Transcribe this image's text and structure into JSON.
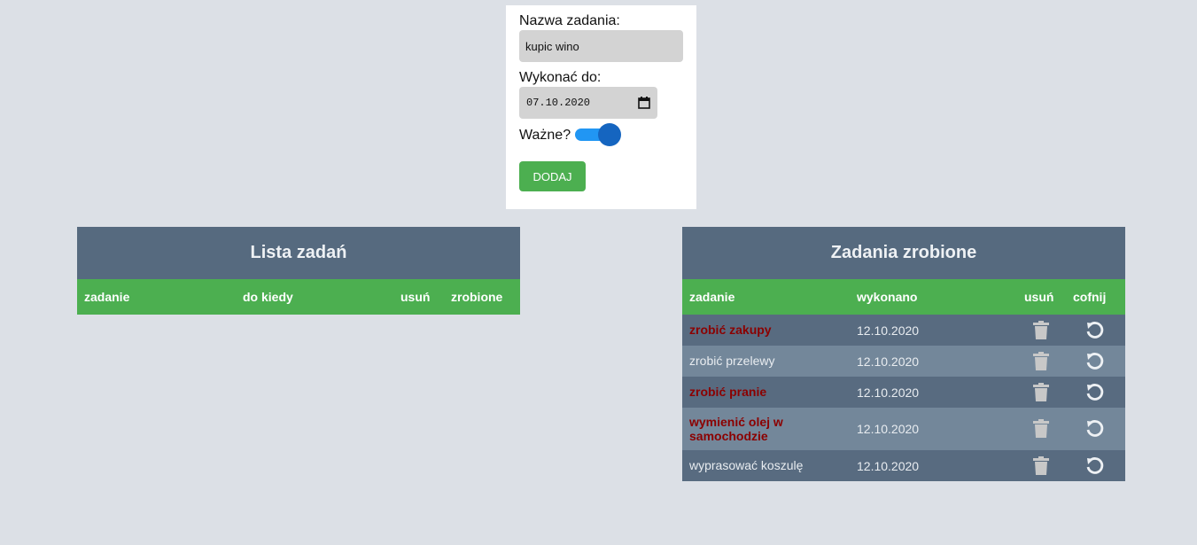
{
  "form": {
    "name_label": "Nazwa zadania:",
    "name_value": "kupic wino",
    "date_label": "Wykonać do:",
    "date_value": "07.10.2020",
    "important_label": "Ważne?",
    "important_checked": true,
    "add_button": "DODAJ"
  },
  "todo": {
    "title": "Lista zadań",
    "columns": [
      "zadanie",
      "do kiedy",
      "usuń",
      "zrobione"
    ]
  },
  "done": {
    "title": "Zadania zrobione",
    "columns": [
      "zadanie",
      "wykonano",
      "usuń",
      "cofnij"
    ],
    "rows": [
      {
        "task": "zrobić zakupy",
        "date": "12.10.2020",
        "important": true
      },
      {
        "task": "zrobić przelewy",
        "date": "12.10.2020",
        "important": false
      },
      {
        "task": "zrobić pranie",
        "date": "12.10.2020",
        "important": true
      },
      {
        "task": "wymienić olej w samochodzie",
        "date": "12.10.2020",
        "important": true
      },
      {
        "task": "wyprasować koszulę",
        "date": "12.10.2020",
        "important": false
      }
    ]
  },
  "colors": {
    "background": "#dce0e6",
    "header": "#566a7f",
    "accent_green": "#4caf50",
    "toggle_blue": "#2196f3",
    "important_text": "#8b0000"
  },
  "icons": {
    "delete": "trash-icon",
    "undo": "undo-icon",
    "date_picker": "calendar-icon"
  }
}
